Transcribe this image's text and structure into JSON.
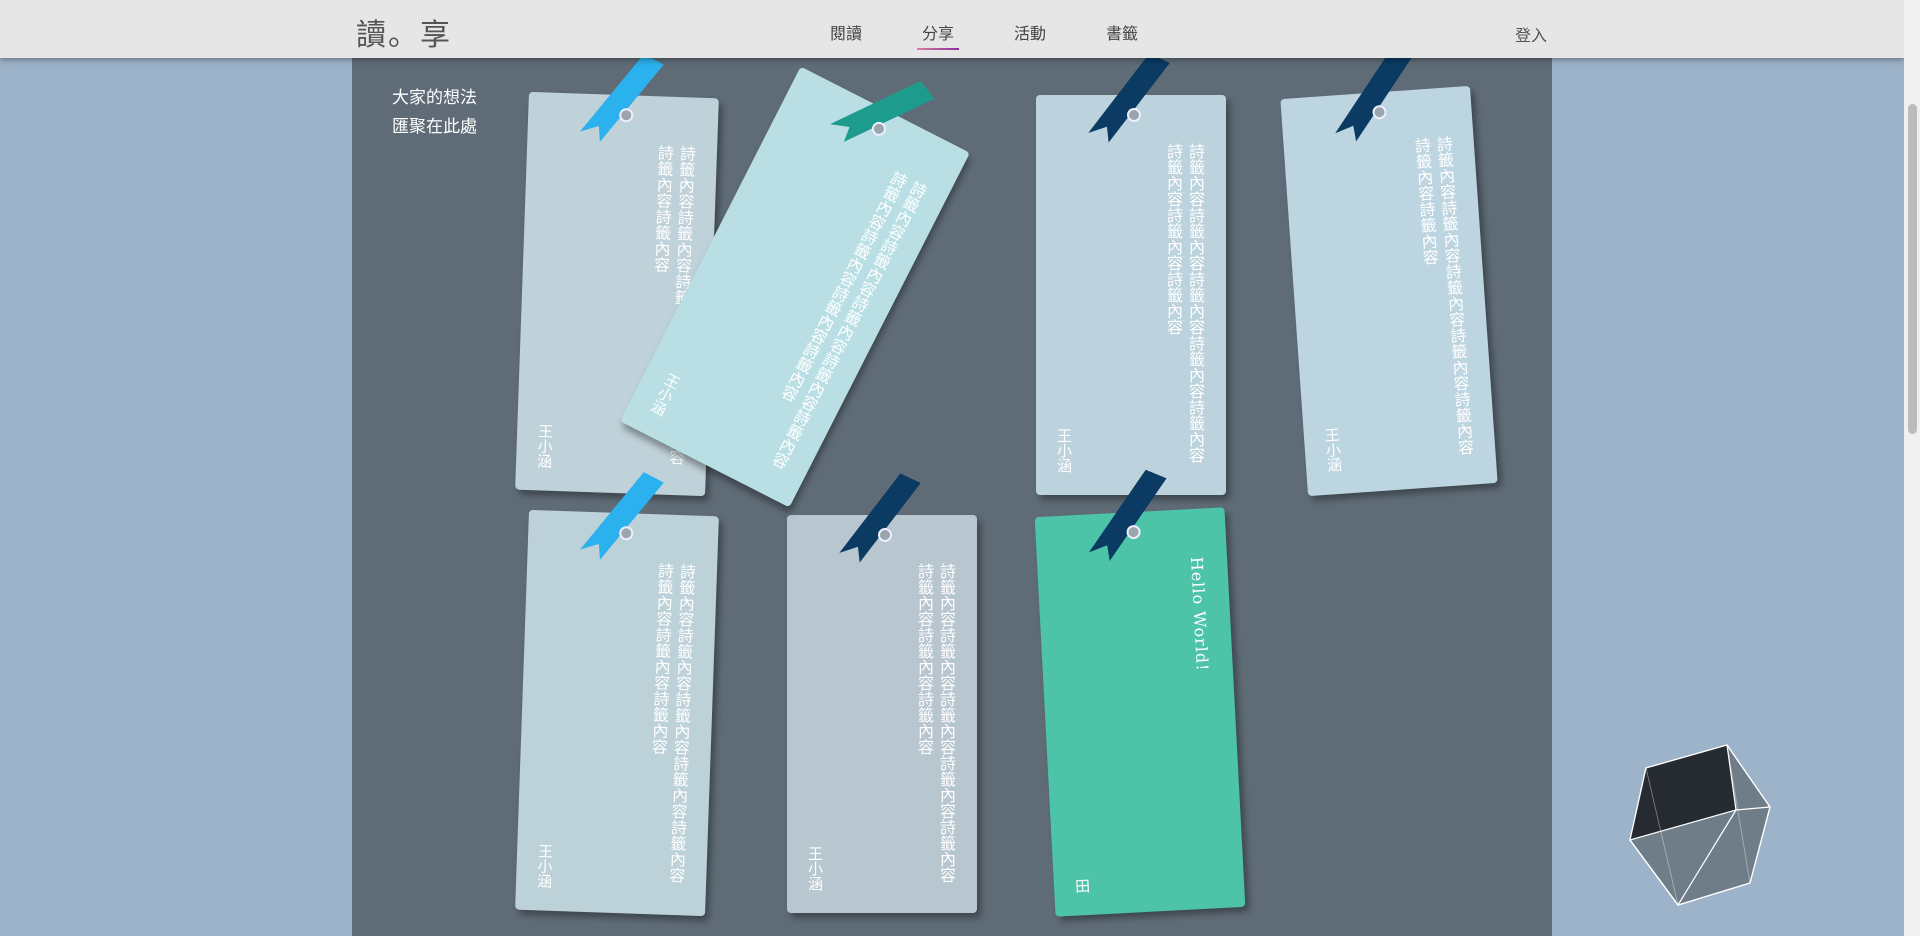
{
  "nav": {
    "brand": "讀。享",
    "items": [
      "閱讀",
      "分享",
      "活動",
      "書籤"
    ],
    "active": "分享",
    "login": "登入"
  },
  "intro": {
    "line1": "大家的想法",
    "line2": "匯聚在此處"
  },
  "cards": [
    {
      "text": "詩籤內容詩籤內容詩籤內容詩籤內容詩籤內容詩籤內容詩籤內容",
      "author": "王小涵",
      "color": "#bfd1d9",
      "ribbon_color": "#2bb1ee"
    },
    {
      "text": "詩籤內容詩籤內容詩籤內容詩籤內容詩籤內容詩籤內容詩籤內容詩籤內容詩籤內容",
      "author": "王小涵",
      "color": "#b9dfe4",
      "ribbon_color": "#1d9c8e"
    },
    {
      "text": "詩籤內容詩籤內容詩籤內容詩籤內容詩籤內容詩籤內容詩籤內容詩籤內容",
      "author": "王小涵",
      "color": "#bcd2dd",
      "ribbon_color": "#0b3a63"
    },
    {
      "text": "詩籤內容詩籤內容詩籤內容詩籤內容詩籤內容詩籤內容詩籤內容",
      "author": "王小涵",
      "color": "#bdd5e0",
      "ribbon_color": "#0b3a63"
    },
    {
      "text": "詩籤內容詩籤內容詩籤內容詩籤內容詩籤內容詩籤內容詩籤內容詩籤內容",
      "author": "王小涵",
      "color": "#bdd1d8",
      "ribbon_color": "#2bb1ee"
    },
    {
      "text": "詩籤內容詩籤內容詩籤內容詩籤內容詩籤內容詩籤內容詩籤內容詩籤內容",
      "author": "王小涵",
      "color": "#b7c6cf",
      "ribbon_color": "#0b3a63"
    },
    {
      "text": "Hello World!",
      "author": "田",
      "color": "#4dc3a8",
      "ribbon_color": "#0b3a63"
    }
  ]
}
